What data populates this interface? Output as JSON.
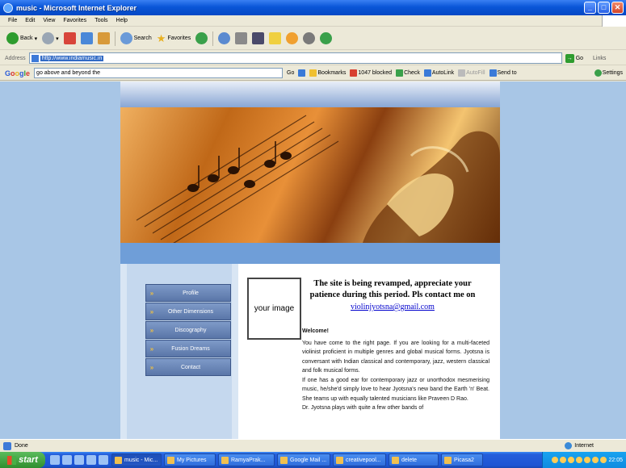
{
  "window": {
    "title": "music - Microsoft Internet Explorer",
    "controls": [
      "_",
      "□",
      "✕"
    ]
  },
  "menu": [
    "File",
    "Edit",
    "View",
    "Favorites",
    "Tools",
    "Help"
  ],
  "toolbar": {
    "back": "Back",
    "search": "Search",
    "favorites": "Favorites"
  },
  "address": {
    "label": "Address",
    "url": "http://www.indiamusic.in",
    "go": "Go",
    "links": "Links"
  },
  "google": {
    "logo": "Google",
    "query": "go above and beyond the",
    "go": "Go",
    "bookmarks": "Bookmarks",
    "blocked": "1047 blocked",
    "check": "Check",
    "autolink": "AutoLink",
    "autofill": "AutoFill",
    "sendto": "Send to",
    "settings": "Settings"
  },
  "site": {
    "nav": [
      "Profile",
      "Other Dimensions",
      "Discography",
      "Fusion Dreams",
      "Contact"
    ],
    "image_placeholder": "your image",
    "headline": "The site is being revamped, appreciate your patience during this period. Pls contact me on",
    "email": "violinjyotsna@gmail.com",
    "welcome": "Welcome!",
    "para1": "You have come to the right page. If you are looking for a multi-faceted violinist proficient in multiple genres and global musical forms. Jyotsna is conversant with Indian classical and contemporary, jazz, western classical and folk musical forms.",
    "para2": "If one has a good ear for contemporary jazz or unorthodox mesmerising music, he/she'd simply love to hear Jyotsna's new band the Earth 'n' Beat. She teams up with equally talented musicians like Praveen D Rao.",
    "para3": "Dr. Jyotsna plays with quite a few other bands of"
  },
  "status": {
    "text": "Done",
    "zone": "Internet"
  },
  "taskbar": {
    "start": "start",
    "tasks": [
      "music - Mic...",
      "My Pictures",
      "RamyaPrak...",
      "Google Mail ...",
      "creativepool...",
      "delete",
      "Picasa2"
    ],
    "clock": "22:05"
  },
  "colors": {
    "page_bg": "#a8c6e6",
    "nav_bg": "#6a86b8",
    "link": "#0000cc"
  }
}
